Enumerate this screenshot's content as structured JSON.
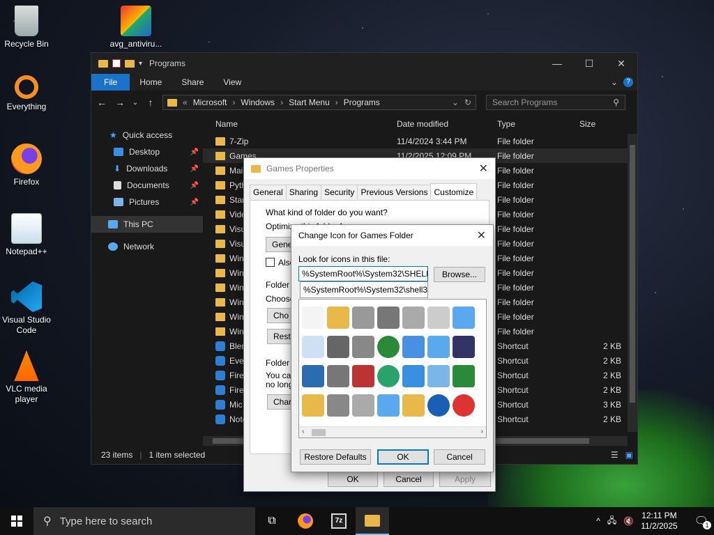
{
  "desktop": {
    "icons": [
      {
        "label": "Recycle Bin"
      },
      {
        "label": "avg_antiviru..."
      },
      {
        "label": "Everything"
      },
      {
        "label": "Firefox"
      },
      {
        "label": "Notepad++"
      },
      {
        "label": "Visual Studio Code"
      },
      {
        "label": "VLC media player"
      }
    ]
  },
  "explorer": {
    "title": "Programs",
    "ribbon_tabs": [
      "File",
      "Home",
      "Share",
      "View"
    ],
    "address": [
      "Microsoft",
      "Windows",
      "Start Menu",
      "Programs"
    ],
    "search_placeholder": "Search Programs",
    "nav": {
      "quick_access": "Quick access",
      "items": [
        "Desktop",
        "Downloads",
        "Documents",
        "Pictures"
      ],
      "this_pc": "This PC",
      "network": "Network"
    },
    "columns": [
      "Name",
      "Date modified",
      "Type",
      "Size"
    ],
    "rows": [
      {
        "name": "7-Zip",
        "date": "11/4/2024 3:44 PM",
        "type": "File folder",
        "size": ""
      },
      {
        "name": "Games",
        "date": "11/2/2025 12:09 PM",
        "type": "File folder",
        "size": ""
      },
      {
        "name": "Mai",
        "date": "",
        "type": "File folder",
        "size": ""
      },
      {
        "name": "Pyth",
        "date": "",
        "type": "File folder",
        "size": ""
      },
      {
        "name": "Star",
        "date": "",
        "type": "File folder",
        "size": ""
      },
      {
        "name": "Vide",
        "date": "",
        "type": "File folder",
        "size": ""
      },
      {
        "name": "Visu",
        "date": "",
        "type": "File folder",
        "size": ""
      },
      {
        "name": "Visu",
        "date": "",
        "type": "File folder",
        "size": ""
      },
      {
        "name": "Win",
        "date": "",
        "type": "File folder",
        "size": ""
      },
      {
        "name": "Win",
        "date": "",
        "type": "File folder",
        "size": ""
      },
      {
        "name": "Win",
        "date": "",
        "type": "File folder",
        "size": ""
      },
      {
        "name": "Win",
        "date": "",
        "type": "File folder",
        "size": ""
      },
      {
        "name": "Win",
        "date": "",
        "type": "File folder",
        "size": ""
      },
      {
        "name": "Win",
        "date": "",
        "type": "File folder",
        "size": ""
      },
      {
        "name": "Blen",
        "date": "",
        "type": "Shortcut",
        "size": "2 KB"
      },
      {
        "name": "Ever",
        "date": "",
        "type": "Shortcut",
        "size": "2 KB"
      },
      {
        "name": "Firef",
        "date": "",
        "type": "Shortcut",
        "size": "2 KB"
      },
      {
        "name": "Firef",
        "date": "",
        "type": "Shortcut",
        "size": "2 KB"
      },
      {
        "name": "Mic",
        "date": "",
        "type": "Shortcut",
        "size": "3 KB"
      },
      {
        "name": "Note",
        "date": "",
        "type": "Shortcut",
        "size": "2 KB"
      }
    ],
    "status_items": "23 items",
    "status_selected": "1 item selected"
  },
  "properties": {
    "title": "Games Properties",
    "tabs": [
      "General",
      "Sharing",
      "Security",
      "Previous Versions",
      "Customize"
    ],
    "q1": "What kind of folder do you want?",
    "optimize": "Optimize this folder for:",
    "dropdown": "Genera",
    "also": "Also",
    "folder_pictures": "Folder p",
    "choose": "Choose",
    "choose_btn": "Cho",
    "restore_btn": "Resto",
    "folder_icons": "Folder ic",
    "you_can": "You car",
    "no_longer": "no longe",
    "change_btn": "Char",
    "ok": "OK",
    "cancel": "Cancel",
    "apply": "Apply"
  },
  "change_icon": {
    "title": "Change Icon for Games Folder",
    "label": "Look for icons in this file:",
    "path": "%SystemRoot%\\System32\\SHELL32",
    "suggestion": "%SystemRoot%\\System32\\shell32",
    "browse": "Browse...",
    "restore_defaults": "Restore Defaults",
    "ok": "OK",
    "cancel": "Cancel"
  },
  "taskbar": {
    "search_placeholder": "Type here to search",
    "time": "12:11 PM",
    "date": "11/2/2025",
    "notif_count": "1"
  }
}
